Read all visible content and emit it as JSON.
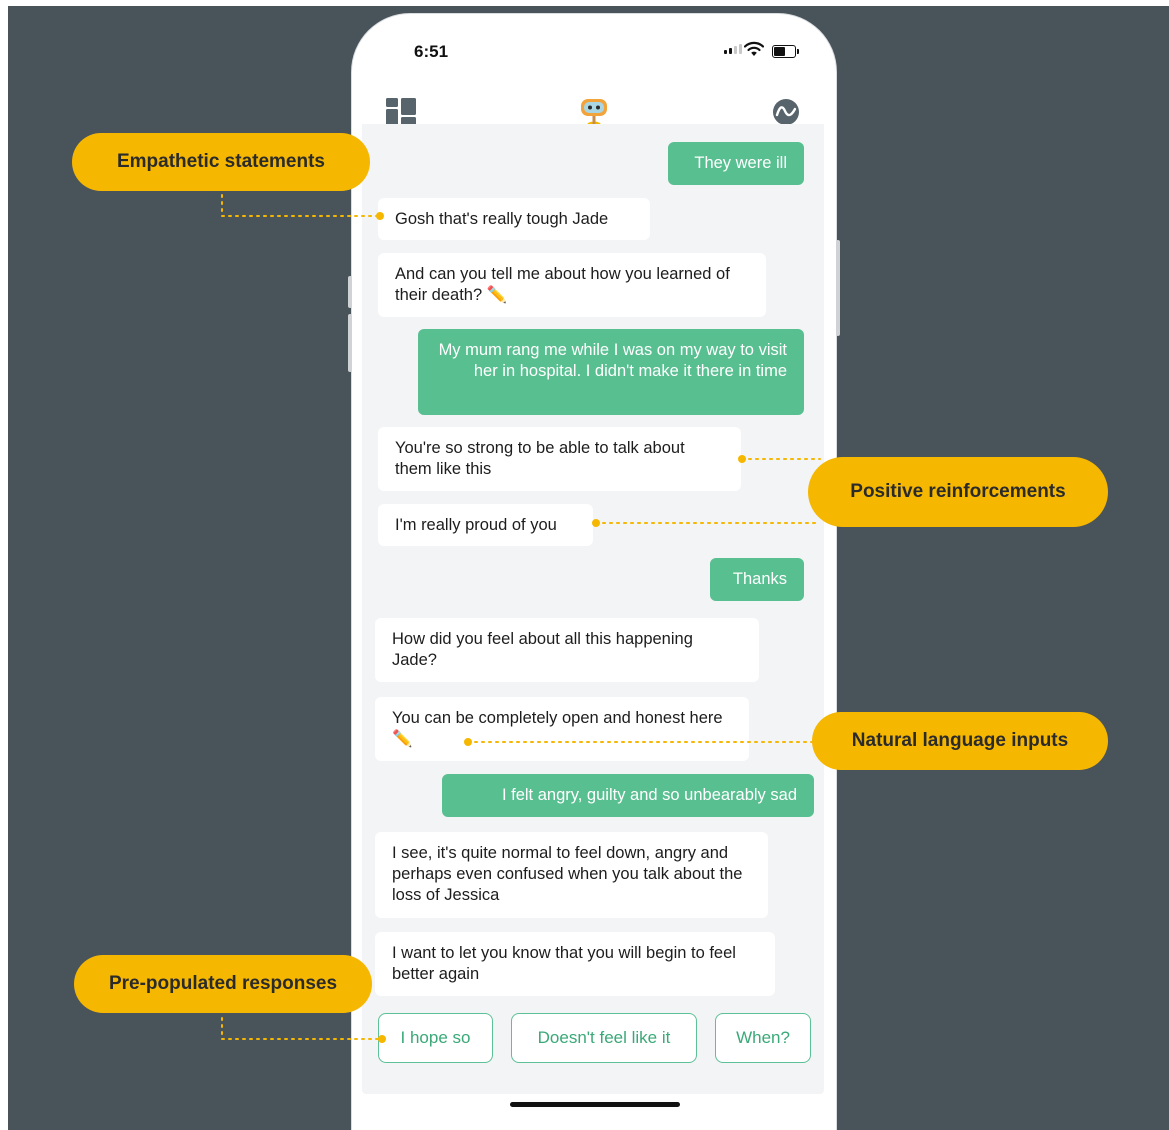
{
  "status_bar": {
    "time": "6:51"
  },
  "header": {
    "left_icon": "dashboard-icon",
    "center_icon": "bot-avatar-icon",
    "right_icon": "pulse-icon"
  },
  "messages": [
    {
      "from": "user",
      "text": "They were ill"
    },
    {
      "from": "bot",
      "text": "Gosh that's really tough Jade"
    },
    {
      "from": "bot",
      "text": "And can you tell me about how you learned of their death? ✏️"
    },
    {
      "from": "user",
      "text": "My mum rang me while I was on my way to visit her in hospital. I didn't make it there in time"
    },
    {
      "from": "bot",
      "text": "You're so strong to be able to talk about them like this"
    },
    {
      "from": "bot",
      "text": "I'm really proud of you"
    },
    {
      "from": "user",
      "text": "Thanks"
    },
    {
      "from": "bot",
      "text": "How did you feel about all this happening Jade?"
    },
    {
      "from": "bot",
      "text": "You can be completely open and honest here ✏️"
    },
    {
      "from": "user",
      "text": "I felt angry, guilty and so unbearably sad"
    },
    {
      "from": "bot",
      "text": "I see, it's quite normal to feel down, angry and perhaps even confused when you talk about the loss of Jessica"
    },
    {
      "from": "bot",
      "text": "I want to let you know that you will begin to feel better again"
    }
  ],
  "quick_replies": [
    "I hope so",
    "Doesn't feel like it",
    "When?"
  ],
  "callouts": {
    "empathetic": "Empathetic statements",
    "positive": "Positive reinforcements",
    "natural": "Natural language inputs",
    "prepopulated": "Pre-populated responses"
  },
  "colors": {
    "accent_green": "#58bf90",
    "callout_yellow": "#f6b700",
    "backdrop": "#48535a"
  }
}
